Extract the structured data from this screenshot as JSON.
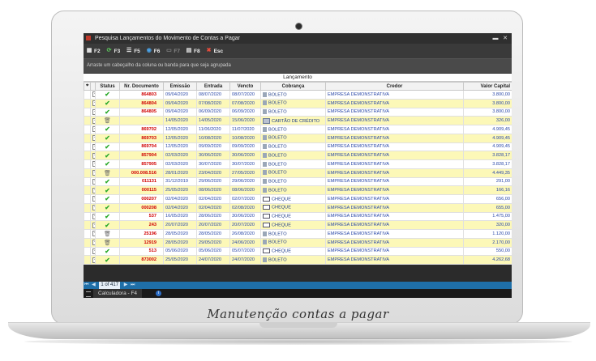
{
  "window": {
    "title": "Pesquisa Lançamentos do Movimento de Contas a Pagar",
    "min_label": "▬",
    "close_label": "✕"
  },
  "toolbar": [
    {
      "key": "F2",
      "label": "F2",
      "icon": "grid-icon",
      "glyph": "▦",
      "enabled": true
    },
    {
      "key": "F3",
      "label": "F3",
      "icon": "refresh-icon",
      "glyph": "⟳",
      "enabled": true
    },
    {
      "key": "F5",
      "label": "F5",
      "icon": "filter-icon",
      "glyph": "☰",
      "enabled": true
    },
    {
      "key": "F6",
      "label": "F6",
      "icon": "globe-icon",
      "glyph": "◉",
      "enabled": true
    },
    {
      "key": "F7",
      "label": "F7",
      "icon": "edit-icon",
      "glyph": "▭",
      "enabled": false
    },
    {
      "key": "F8",
      "label": "F8",
      "icon": "print-icon",
      "glyph": "▤",
      "enabled": true
    },
    {
      "key": "Esc",
      "label": "Esc",
      "icon": "close-icon",
      "glyph": "✖",
      "enabled": true
    }
  ],
  "group_hint": "Arraste um cabeçalho da coluna ou banda para que seja agrupada",
  "band_label": "Lançamento",
  "columns": [
    "Status",
    "Nr. Documento",
    "Emissão",
    "Entrada",
    "Vencto",
    "Cobrança",
    "Credor",
    "Valor Capital"
  ],
  "rows": [
    {
      "status": "check",
      "doc": "864803",
      "emissao": "09/04/2020",
      "entrada": "08/07/2020",
      "vencto": "08/07/2020",
      "cobranca": "BOLETO",
      "cob_icon": "document-icon",
      "credor": "EMPRESA DEMONSTRATIVA",
      "valor": "3.800,00",
      "hl": "white"
    },
    {
      "status": "check",
      "doc": "864804",
      "emissao": "09/04/2020",
      "entrada": "07/08/2020",
      "vencto": "07/08/2020",
      "cobranca": "BOLETO",
      "cob_icon": "document-icon",
      "credor": "EMPRESA DEMONSTRATIVA",
      "valor": "3.800,00",
      "hl": "yellow"
    },
    {
      "status": "check",
      "doc": "864805",
      "emissao": "09/04/2020",
      "entrada": "06/09/2020",
      "vencto": "06/09/2020",
      "cobranca": "BOLETO",
      "cob_icon": "document-icon",
      "credor": "EMPRESA DEMONSTRATIVA",
      "valor": "3.800,00",
      "hl": "white"
    },
    {
      "status": "trash",
      "doc": "",
      "emissao": "14/05/2020",
      "entrada": "14/05/2020",
      "vencto": "15/06/2020",
      "cobranca": "CARTÃO DE CRÉDITO",
      "cob_icon": "card-icon",
      "credor": "EMPRESA DEMONSTRATIVA",
      "valor": "326,00",
      "hl": "yellow"
    },
    {
      "status": "check",
      "doc": "869702",
      "emissao": "12/05/2020",
      "entrada": "11/06/2020",
      "vencto": "11/07/2020",
      "cobranca": "BOLETO",
      "cob_icon": "document-icon",
      "credor": "EMPRESA DEMONSTRATIVA",
      "valor": "4.909,45",
      "hl": "white"
    },
    {
      "status": "check",
      "doc": "869703",
      "emissao": "12/05/2020",
      "entrada": "10/08/2020",
      "vencto": "10/08/2020",
      "cobranca": "BOLETO",
      "cob_icon": "document-icon",
      "credor": "EMPRESA DEMONSTRATIVA",
      "valor": "4.909,45",
      "hl": "yellow"
    },
    {
      "status": "check",
      "doc": "869704",
      "emissao": "12/05/2020",
      "entrada": "09/09/2020",
      "vencto": "09/09/2020",
      "cobranca": "BOLETO",
      "cob_icon": "document-icon",
      "credor": "EMPRESA DEMONSTRATIVA",
      "valor": "4.909,45",
      "hl": "white"
    },
    {
      "status": "check",
      "doc": "857904",
      "emissao": "02/03/2020",
      "entrada": "30/06/2020",
      "vencto": "30/06/2020",
      "cobranca": "BOLETO",
      "cob_icon": "document-icon",
      "credor": "EMPRESA DEMONSTRATIVA",
      "valor": "3.828,17",
      "hl": "yellow"
    },
    {
      "status": "check",
      "doc": "857905",
      "emissao": "02/03/2020",
      "entrada": "30/07/2020",
      "vencto": "30/07/2020",
      "cobranca": "BOLETO",
      "cob_icon": "document-icon",
      "credor": "EMPRESA DEMONSTRATIVA",
      "valor": "3.828,17",
      "hl": "white"
    },
    {
      "status": "trash",
      "doc": "000.008.516",
      "emissao": "28/01/2020",
      "entrada": "23/04/2020",
      "vencto": "27/05/2020",
      "cobranca": "BOLETO",
      "cob_icon": "document-icon",
      "credor": "EMPRESA DEMONSTRATIVA",
      "valor": "4.449,35",
      "hl": "yellow"
    },
    {
      "status": "check",
      "doc": "011131",
      "emissao": "31/12/2019",
      "entrada": "29/06/2020",
      "vencto": "29/06/2020",
      "cobranca": "BOLETO",
      "cob_icon": "document-icon",
      "credor": "EMPRESA DEMONSTRATIVA",
      "valor": "291,00",
      "hl": "white"
    },
    {
      "status": "check",
      "doc": "000115",
      "emissao": "25/05/2020",
      "entrada": "08/06/2020",
      "vencto": "08/06/2020",
      "cobranca": "BOLETO",
      "cob_icon": "document-icon",
      "credor": "EMPRESA DEMONSTRATIVA",
      "valor": "166,16",
      "hl": "yellow"
    },
    {
      "status": "check",
      "doc": "000207",
      "emissao": "02/04/2020",
      "entrada": "02/04/2020",
      "vencto": "02/07/2020",
      "cobranca": "CHEQUE",
      "cob_icon": "cheque-icon",
      "credor": "EMPRESA DEMONSTRATIVA",
      "valor": "656,00",
      "hl": "white"
    },
    {
      "status": "check",
      "doc": "000208",
      "emissao": "02/04/2020",
      "entrada": "02/04/2020",
      "vencto": "02/08/2020",
      "cobranca": "CHEQUE",
      "cob_icon": "cheque-icon",
      "credor": "EMPRESA DEMONSTRATIVA",
      "valor": "655,00",
      "hl": "yellow"
    },
    {
      "status": "check",
      "doc": "537",
      "emissao": "16/05/2020",
      "entrada": "28/06/2020",
      "vencto": "30/06/2020",
      "cobranca": "CHEQUE",
      "cob_icon": "cheque-icon",
      "credor": "EMPRESA DEMONSTRATIVA",
      "valor": "1.475,00",
      "hl": "white"
    },
    {
      "status": "check",
      "doc": "243",
      "emissao": "20/07/2020",
      "entrada": "20/07/2020",
      "vencto": "20/07/2020",
      "cobranca": "CHEQUE",
      "cob_icon": "cheque-icon",
      "credor": "EMPRESA DEMONSTRATIVA",
      "valor": "320,00",
      "hl": "yellow"
    },
    {
      "status": "trash",
      "doc": "25196",
      "emissao": "28/05/2020",
      "entrada": "28/05/2020",
      "vencto": "26/08/2020",
      "cobranca": "BOLETO",
      "cob_icon": "document-icon",
      "credor": "EMPRESA DEMONSTRATIVA",
      "valor": "1.120,00",
      "hl": "white"
    },
    {
      "status": "trash",
      "doc": "12919",
      "emissao": "28/05/2020",
      "entrada": "29/05/2020",
      "vencto": "24/06/2020",
      "cobranca": "BOLETO",
      "cob_icon": "document-icon",
      "credor": "EMPRESA DEMONSTRATIVA",
      "valor": "2.170,00",
      "hl": "yellow"
    },
    {
      "status": "check",
      "doc": "513",
      "emissao": "05/06/2020",
      "entrada": "05/06/2020",
      "vencto": "05/07/2020",
      "cobranca": "CHEQUE",
      "cob_icon": "cheque-icon",
      "credor": "EMPRESA DEMONSTRATIVA",
      "valor": "550,00",
      "hl": "white"
    },
    {
      "status": "check",
      "doc": "873002",
      "emissao": "25/05/2020",
      "entrada": "24/07/2020",
      "vencto": "24/07/2020",
      "cobranca": "BOLETO",
      "cob_icon": "document-icon",
      "credor": "EMPRESA DEMONSTRATIVA",
      "valor": "4.262,68",
      "hl": "yellow"
    }
  ],
  "pager": {
    "label": "1 of 417",
    "first": "⏮",
    "prev": "◀",
    "next": "▶",
    "last": "⏭"
  },
  "taskbar": {
    "task_label": "Calculadora - F4",
    "info_glyph": "i"
  },
  "caption": "Manutenção contas a pagar"
}
